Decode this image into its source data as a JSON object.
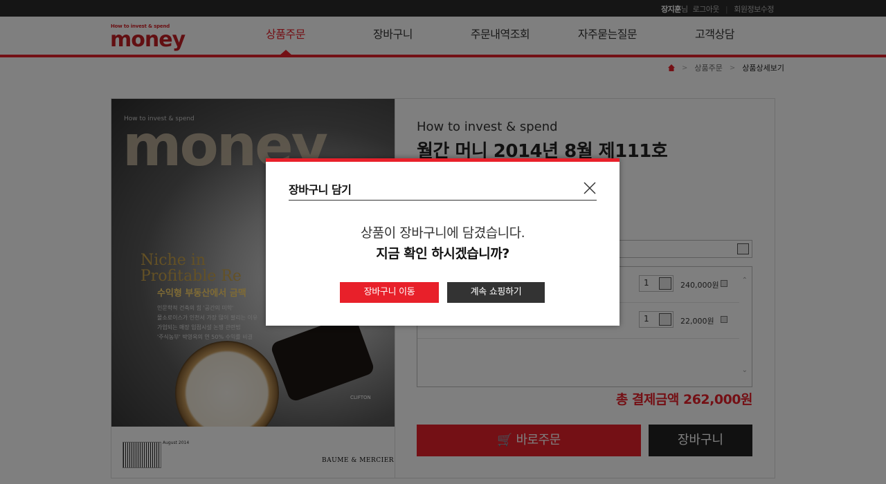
{
  "topbar": {
    "user_name": "장지훈",
    "user_suffix": "님",
    "logout": "로그아웃",
    "edit_profile": "회원정보수정"
  },
  "header": {
    "logo_small": "How to invest & spend",
    "logo_big": "money",
    "nav": [
      "상품주문",
      "장바구니",
      "주문내역조회",
      "자주묻는질문",
      "고객상담"
    ],
    "active_index": 0
  },
  "breadcrumb": {
    "items": [
      "상품주문",
      "상품상세보기"
    ]
  },
  "product": {
    "cover": {
      "mag_small": "How to invest & spend",
      "mag_title": "money",
      "niche_line1": "Niche in",
      "niche_line2": "Profitable Re",
      "kr_head": "수익형 부동산에서 금맥",
      "kr_line1": "인문학적 건축의 힘 '공간의 미학'",
      "kr_line2": "몰소로이스가 인천서 가장 많이 팔리는 이유",
      "kr_line3": "가업되는 매장 입점시설 논쟁 관련법",
      "kr_line4": "'주식농부' 박영옥의 연 50% 수익률 비결",
      "issue_date": "August 2014",
      "brand": "BAUME & MERCIER",
      "model": "CLIFTON"
    },
    "subtitle": "How to invest & spend",
    "title": "월간 머니 2014년 8월 제111호",
    "options": [
      {
        "qty": "1",
        "price": "240,000원"
      },
      {
        "qty": "1",
        "price": "22,000원"
      }
    ],
    "total_label": "총 결제금액",
    "total_value": "262,000원",
    "buy_label": "바로주문",
    "cart_label": "장바구니"
  },
  "modal": {
    "title": "장바구니 담기",
    "message_line1": "상품이 장바구니에 담겼습니다.",
    "message_line2": "지금 확인 하시겠습니까?",
    "go_cart_label": "장바구니 이동",
    "continue_label": "계속 쇼핑하기"
  },
  "colors": {
    "accent": "#e8202a",
    "dark": "#222222"
  }
}
